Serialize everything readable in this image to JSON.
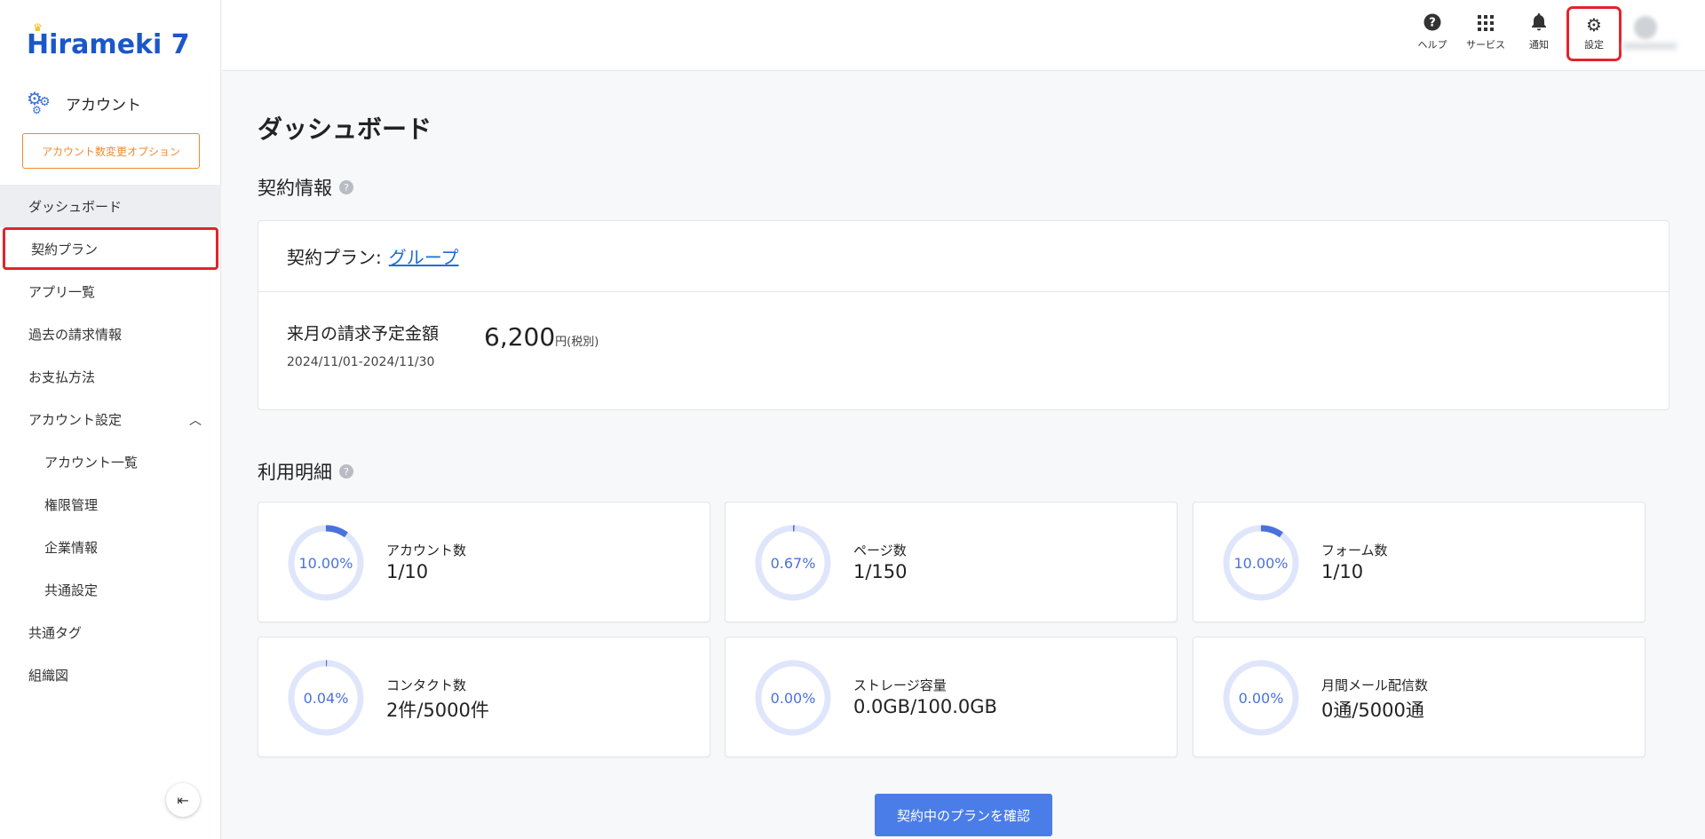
{
  "brand": {
    "logo_text": "Hirameki 7"
  },
  "sidebar": {
    "section_title": "アカウント",
    "option_button": "アカウント数変更オプション",
    "items": [
      {
        "label": "ダッシュボード"
      },
      {
        "label": "契約プラン"
      },
      {
        "label": "アプリ一覧"
      },
      {
        "label": "過去の請求情報"
      },
      {
        "label": "お支払方法"
      },
      {
        "label": "アカウント設定"
      },
      {
        "label": "アカウント一覧"
      },
      {
        "label": "権限管理"
      },
      {
        "label": "企業情報"
      },
      {
        "label": "共通設定"
      },
      {
        "label": "共通タグ"
      },
      {
        "label": "組織図"
      }
    ]
  },
  "header": {
    "help": "ヘルプ",
    "services": "サービス",
    "notifications": "通知",
    "settings": "設定"
  },
  "main": {
    "title": "ダッシュボード",
    "contract_section": "契約情報",
    "plan_label": "契約プラン:",
    "plan_value": "グループ",
    "billing_label": "来月の請求予定金額",
    "billing_period": "2024/11/01-2024/11/30",
    "billing_amount": "6,200",
    "billing_unit": "円(税別)",
    "usage_section": "利用明細",
    "stats": [
      {
        "name": "アカウント数",
        "value": "1/10",
        "percent": "10.00%",
        "ratio": 0.1
      },
      {
        "name": "ページ数",
        "value": "1/150",
        "percent": "0.67%",
        "ratio": 0.0067
      },
      {
        "name": "フォーム数",
        "value": "1/10",
        "percent": "10.00%",
        "ratio": 0.1
      },
      {
        "name": "コンタクト数",
        "value": "2件/5000件",
        "percent": "0.04%",
        "ratio": 0.0004
      },
      {
        "name": "ストレージ容量",
        "value": "0.0GB/100.0GB",
        "percent": "0.00%",
        "ratio": 0
      },
      {
        "name": "月間メール配信数",
        "value": "0通/5000通",
        "percent": "0.00%",
        "ratio": 0
      }
    ],
    "confirm_button": "契約中のプランを確認"
  },
  "colors": {
    "accent": "#4a7de8",
    "option_border": "#f08a2c",
    "highlight": "#e3242b",
    "ring_track": "#dfe6fb",
    "ring_fill": "#4a72dc"
  }
}
